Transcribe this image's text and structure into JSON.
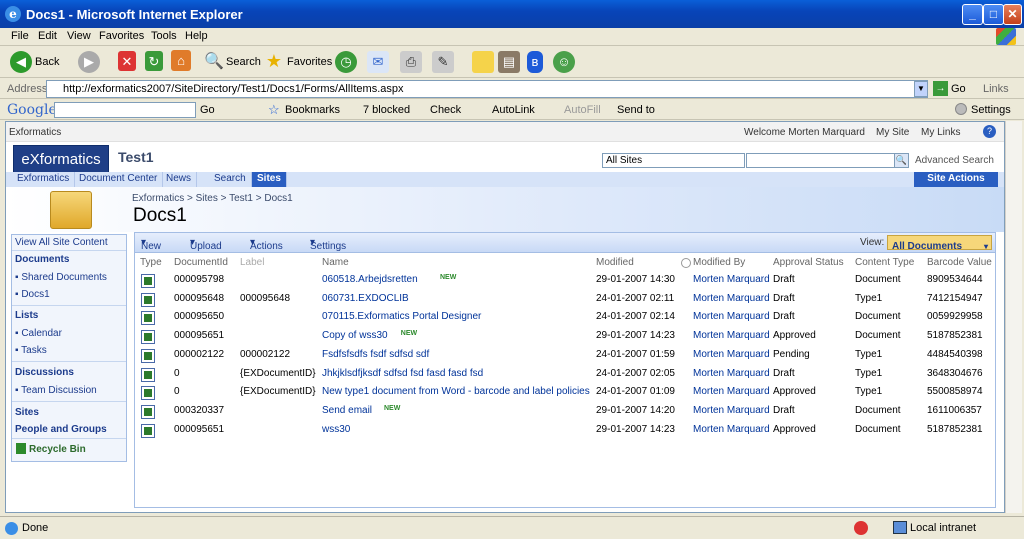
{
  "window": {
    "title": "Docs1 - Microsoft Internet Explorer",
    "min": "_",
    "max": "□",
    "close": "✕"
  },
  "menu": [
    "File",
    "Edit",
    "View",
    "Favorites",
    "Tools",
    "Help"
  ],
  "toolbar": {
    "back": "Back",
    "search": "Search",
    "favorites": "Favorites"
  },
  "address": {
    "label": "Address",
    "url": "http://exformatics2007/SiteDirectory/Test1/Docs1/Forms/AllItems.aspx",
    "go": "Go",
    "links": "Links"
  },
  "google": {
    "logo": "Google",
    "go": "Go",
    "bookmarks": "Bookmarks",
    "blocked": "7 blocked",
    "check": "Check",
    "autolink": "AutoLink",
    "autofill": "AutoFill",
    "sendto": "Send to",
    "settings": "Settings"
  },
  "sp": {
    "site_crumb": "Exformatics",
    "welcome": "Welcome Morten Marquard",
    "my_site": "My Site",
    "my_links": "My Links",
    "logo": "eXformatics",
    "site_title": "Test1",
    "scope": "All Sites",
    "advanced_search": "Advanced Search",
    "tabs": [
      "Exformatics",
      "Document Center",
      "News",
      "Search",
      "Sites"
    ],
    "site_actions": "Site Actions",
    "breadcrumb": "Exformatics > Sites > Test1 > Docs1",
    "page_title": "Docs1",
    "nav": {
      "view_all": "View All Site Content",
      "documents": "Documents",
      "doc_items": [
        "Shared Documents",
        "Docs1"
      ],
      "lists": "Lists",
      "list_items": [
        "Calendar",
        "Tasks"
      ],
      "discussions": "Discussions",
      "disc_items": [
        "Team Discussion"
      ],
      "sites": "Sites",
      "people": "People and Groups",
      "recycle": "Recycle Bin"
    },
    "list_toolbar": {
      "new": "New",
      "upload": "Upload",
      "actions": "Actions",
      "settings": "Settings",
      "view_label": "View:",
      "view": "All Documents"
    },
    "columns": [
      "Type",
      "DocumentId",
      "Label",
      "Name",
      "Modified",
      "Modified By",
      "Approval Status",
      "Content Type",
      "Barcode Value"
    ],
    "rows": [
      {
        "id": "000095798",
        "label": "",
        "name": "060518.Arbejdsretten",
        "new": true,
        "modified": "29-01-2007 14:30",
        "by": "Morten Marquard",
        "status": "Draft",
        "ctype": "Document",
        "barcode": "8909534644"
      },
      {
        "id": "000095648",
        "label": "000095648",
        "name": "060731.EXDOCLIB",
        "new": false,
        "modified": "24-01-2007 02:11",
        "by": "Morten Marquard",
        "status": "Draft",
        "ctype": "Type1",
        "barcode": "7412154947"
      },
      {
        "id": "000095650",
        "label": "",
        "name": "070115.Exformatics Portal Designer",
        "new": false,
        "modified": "24-01-2007 02:14",
        "by": "Morten Marquard",
        "status": "Draft",
        "ctype": "Document",
        "barcode": "0059929958"
      },
      {
        "id": "000095651",
        "label": "",
        "name": "Copy of wss30",
        "new": true,
        "modified": "29-01-2007 14:23",
        "by": "Morten Marquard",
        "status": "Approved",
        "ctype": "Document",
        "barcode": "5187852381"
      },
      {
        "id": "000002122",
        "label": "000002122",
        "name": "Fsdfsfsdfs fsdf sdfsd sdf",
        "new": false,
        "modified": "24-01-2007 01:59",
        "by": "Morten Marquard",
        "status": "Pending",
        "ctype": "Type1",
        "barcode": "4484540398"
      },
      {
        "id": "0",
        "label": "{EXDocumentID}",
        "name": "Jhkjklsdfjksdf sdfsd fsd fasd fasd fsd",
        "new": false,
        "modified": "24-01-2007 02:05",
        "by": "Morten Marquard",
        "status": "Draft",
        "ctype": "Type1",
        "barcode": "3648304676"
      },
      {
        "id": "0",
        "label": "{EXDocumentID}",
        "name": "New type1 document from Word - barcode and label policies",
        "new": false,
        "modified": "24-01-2007 01:09",
        "by": "Morten Marquard",
        "status": "Approved",
        "ctype": "Type1",
        "barcode": "5500858974"
      },
      {
        "id": "000320337",
        "label": "",
        "name": "Send email",
        "new": true,
        "modified": "29-01-2007 14:20",
        "by": "Morten Marquard",
        "status": "Draft",
        "ctype": "Document",
        "barcode": "1611006357"
      },
      {
        "id": "000095651",
        "label": "",
        "name": "wss30",
        "new": false,
        "modified": "29-01-2007 14:23",
        "by": "Morten Marquard",
        "status": "Approved",
        "ctype": "Document",
        "barcode": "5187852381"
      }
    ],
    "new_label": "NEW"
  },
  "status": {
    "text": "Done",
    "zone": "Local intranet"
  }
}
